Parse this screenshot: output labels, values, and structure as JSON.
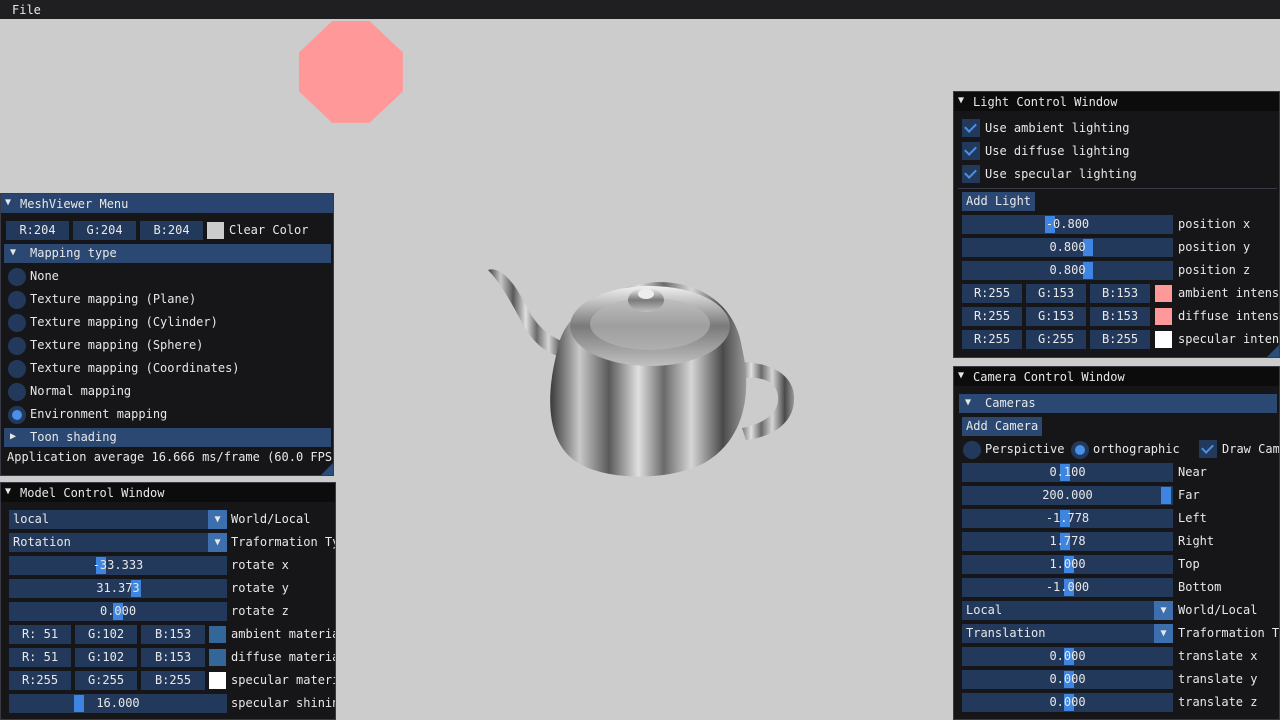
{
  "menubar": {
    "file": "File"
  },
  "colors": {
    "light_sphere": "#ff9999",
    "background": "#cccccc"
  },
  "mesh_menu": {
    "title": "MeshViewer Menu",
    "clear_r": "R:204",
    "clear_g": "G:204",
    "clear_b": "B:204",
    "clear_label": "Clear Color",
    "mapping_header": "Mapping type",
    "options": [
      "None",
      "Texture mapping (Plane)",
      "Texture mapping (Cylinder)",
      "Texture mapping (Sphere)",
      "Texture mapping (Coordinates)",
      "Normal mapping",
      "Environment mapping"
    ],
    "selected_option": "Environment mapping",
    "toon_header": "Toon shading",
    "fps": "Application average 16.666 ms/frame (60.0 FPS)"
  },
  "model_window": {
    "title": "Model Control Window",
    "space_value": "local",
    "space_label": "World/Local",
    "transform_value": "Rotation",
    "transform_label": "Traformation Ty",
    "rotate_x": "-33.333",
    "rotate_x_label": "rotate x",
    "rotate_y": "31.373",
    "rotate_y_label": "rotate y",
    "rotate_z": "0.000",
    "rotate_z_label": "rotate z",
    "ambient": {
      "r": "R: 51",
      "g": "G:102",
      "b": "B:153",
      "label": "ambient materia",
      "color": "#336699"
    },
    "diffuse": {
      "r": "R: 51",
      "g": "G:102",
      "b": "B:153",
      "label": "diffuse materia",
      "color": "#336699"
    },
    "specular": {
      "r": "R:255",
      "g": "G:255",
      "b": "B:255",
      "label": "specular materi",
      "color": "#ffffff"
    },
    "shininess": "16.000",
    "shininess_label": "specular shinin"
  },
  "light_window": {
    "title": "Light Control Window",
    "use_ambient": "Use ambient lighting",
    "use_diffuse": "Use diffuse lighting",
    "use_specular": "Use specular lighting",
    "add_light": "Add Light",
    "pos_x": "-0.800",
    "pos_x_label": "position x",
    "pos_y": "0.800",
    "pos_y_label": "position y",
    "pos_z": "0.800",
    "pos_z_label": "position z",
    "ambient": {
      "r": "R:255",
      "g": "G:153",
      "b": "B:153",
      "label": "ambient intens",
      "color": "#ff9999"
    },
    "diffuse": {
      "r": "R:255",
      "g": "G:153",
      "b": "B:153",
      "label": "diffuse intens",
      "color": "#ff9999"
    },
    "specular": {
      "r": "R:255",
      "g": "G:255",
      "b": "B:255",
      "label": "specular inten",
      "color": "#ffffff"
    }
  },
  "camera_window": {
    "title": "Camera Control Window",
    "cameras_header": "Cameras",
    "add_camera": "Add Camera",
    "perspective": "Perspictive",
    "orthographic": "orthographic",
    "draw_cam": "Draw Cam",
    "near": "0.100",
    "near_label": "Near",
    "far": "200.000",
    "far_label": "Far",
    "left": "-1.778",
    "left_label": "Left",
    "right": "1.778",
    "right_label": "Right",
    "top": "1.000",
    "top_label": "Top",
    "bottom": "-1.000",
    "bottom_label": "Bottom",
    "space_value": "Local",
    "space_label": "World/Local",
    "transform_value": "Translation",
    "transform_label": "Traformation T",
    "tx": "0.000",
    "tx_label": "translate x",
    "ty": "0.000",
    "ty_label": "translate y",
    "tz": "0.000",
    "tz_label": "translate z"
  }
}
